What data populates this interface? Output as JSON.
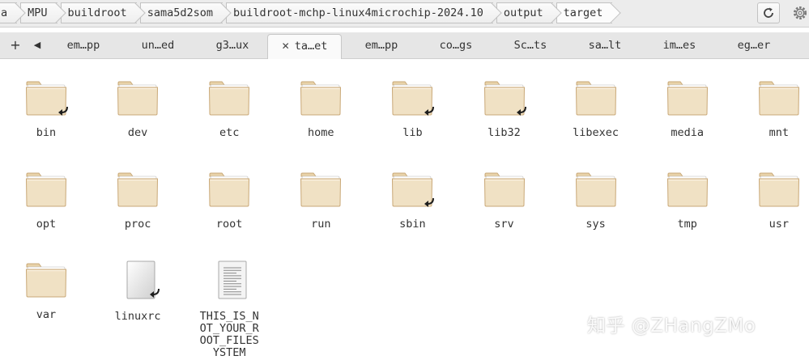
{
  "path": {
    "crumbs": [
      "a",
      "MPU",
      "buildroot",
      "sama5d2som",
      "buildroot-mchp-linux4microchip-2024.10",
      "output",
      "target"
    ]
  },
  "tabs": {
    "add_icon": "+",
    "prev_icon": "◀",
    "close_icon": "✕",
    "items": [
      "em…pp",
      "un…ed",
      "g3…ux",
      "ta…et",
      "em…pp",
      "co…gs",
      "Sc…ts",
      "sa…lt",
      "im…es",
      "eg…er"
    ],
    "active_index": 3
  },
  "files": [
    {
      "name": "bin",
      "kind": "folder",
      "link": true
    },
    {
      "name": "dev",
      "kind": "folder",
      "link": false
    },
    {
      "name": "etc",
      "kind": "folder",
      "link": false
    },
    {
      "name": "home",
      "kind": "folder",
      "link": false
    },
    {
      "name": "lib",
      "kind": "folder",
      "link": true
    },
    {
      "name": "lib32",
      "kind": "folder",
      "link": true
    },
    {
      "name": "libexec",
      "kind": "folder",
      "link": false
    },
    {
      "name": "media",
      "kind": "folder",
      "link": false
    },
    {
      "name": "mnt",
      "kind": "folder",
      "link": false
    },
    {
      "name": "opt",
      "kind": "folder",
      "link": false
    },
    {
      "name": "proc",
      "kind": "folder",
      "link": false
    },
    {
      "name": "root",
      "kind": "folder",
      "link": false
    },
    {
      "name": "run",
      "kind": "folder",
      "link": false
    },
    {
      "name": "sbin",
      "kind": "folder",
      "link": true
    },
    {
      "name": "srv",
      "kind": "folder",
      "link": false
    },
    {
      "name": "sys",
      "kind": "folder",
      "link": false
    },
    {
      "name": "tmp",
      "kind": "folder",
      "link": false
    },
    {
      "name": "usr",
      "kind": "folder",
      "link": false
    },
    {
      "name": "var",
      "kind": "folder",
      "link": false
    },
    {
      "name": "linuxrc",
      "kind": "file",
      "link": true
    },
    {
      "name": "THIS_IS_NOT_YOUR_ROOT_FILESYSTEM",
      "kind": "text",
      "link": false
    }
  ],
  "watermark": "知乎 @ZHangZMo",
  "colors": {
    "folder_body": "#f0e1c4",
    "folder_edge": "#c9a877",
    "folder_tab": "#e8d2a8"
  }
}
